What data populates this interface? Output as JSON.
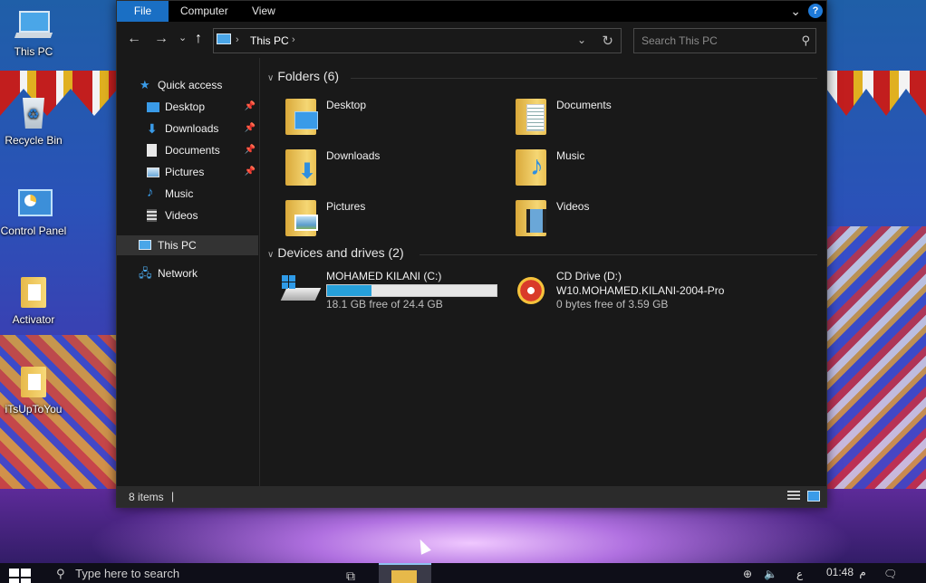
{
  "desktop": {
    "icons": [
      {
        "label": "This PC",
        "icon": "this-pc-icon"
      },
      {
        "label": "Recycle Bin",
        "icon": "recycle-bin-icon"
      },
      {
        "label": "Control Panel",
        "icon": "control-panel-icon"
      },
      {
        "label": "Activator",
        "icon": "folder-icon"
      },
      {
        "label": "iTsUpToYou",
        "icon": "folder-icon"
      }
    ]
  },
  "window": {
    "ribbon": {
      "tabs": [
        "File",
        "Computer",
        "View"
      ],
      "help": "?"
    },
    "navbar": {
      "back": "←",
      "forward": "→",
      "recent": "⌄",
      "up": "↑",
      "breadcrumb": [
        "This PC"
      ],
      "search_placeholder": "Search This PC"
    },
    "nav_pane": {
      "quick_access": "Quick access",
      "quick_items": [
        {
          "label": "Desktop",
          "pinned": true
        },
        {
          "label": "Downloads",
          "pinned": true
        },
        {
          "label": "Documents",
          "pinned": true
        },
        {
          "label": "Pictures",
          "pinned": true
        },
        {
          "label": "Music",
          "pinned": false
        },
        {
          "label": "Videos",
          "pinned": false
        }
      ],
      "this_pc": "This PC",
      "network": "Network"
    },
    "folders": {
      "header": "Folders (6)",
      "items": [
        "Desktop",
        "Documents",
        "Downloads",
        "Music",
        "Pictures",
        "Videos"
      ]
    },
    "drives": {
      "header": "Devices and drives (2)",
      "items": [
        {
          "name": "MOHAMED KILANI (C:)",
          "free": "18.1 GB free of 24.4 GB",
          "used_fraction": 0.26
        },
        {
          "name": "CD Drive (D:)",
          "label": "W10.MOHAMED.KILANI-2004-Pro",
          "free": "0 bytes free of 3.59 GB"
        }
      ]
    },
    "status": {
      "count": "8 items",
      "separator": "|"
    }
  },
  "taskbar": {
    "search_placeholder": "Type here to search",
    "tray_lang": "ع",
    "clock_time": "01:48",
    "clock_suffix": "م"
  },
  "colors": {
    "accent": "#1a6fc4",
    "window_bg": "#191919",
    "drive_fill": "#26a0da"
  }
}
